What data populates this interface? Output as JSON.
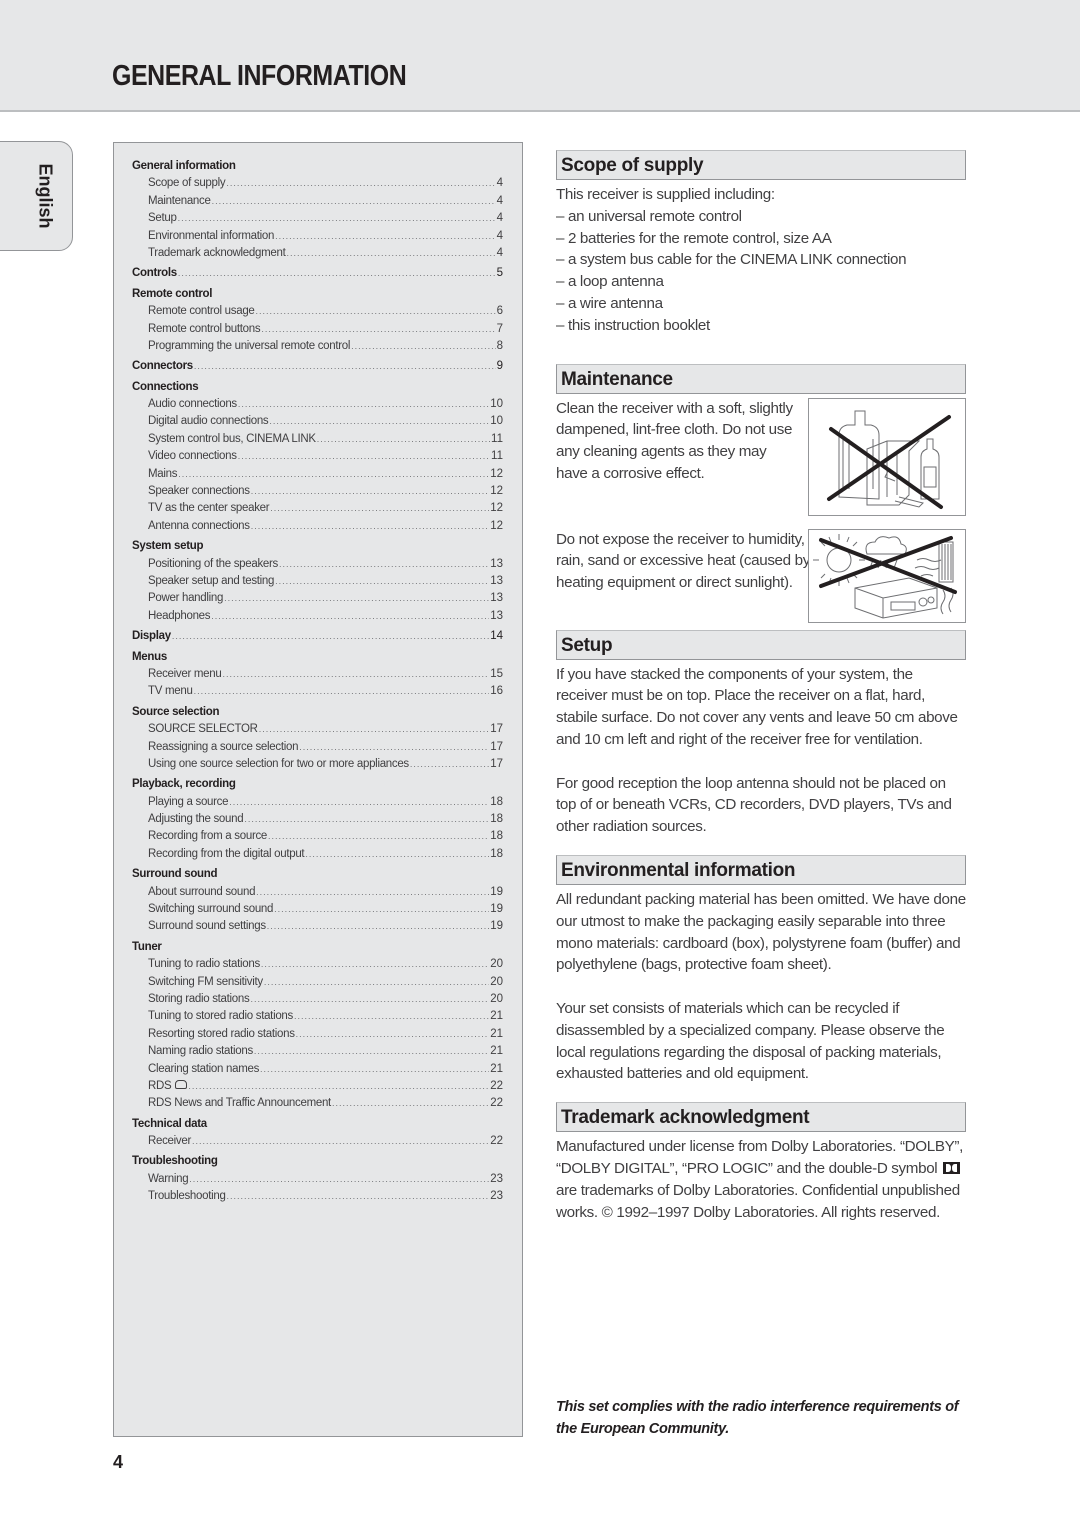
{
  "header": {
    "title": "GENERAL INFORMATION"
  },
  "language_tab": "English",
  "toc": {
    "sections": [
      {
        "title": "General information",
        "page": "",
        "items": [
          {
            "label": "Scope of supply",
            "page": "4"
          },
          {
            "label": "Maintenance",
            "page": "4"
          },
          {
            "label": "Setup",
            "page": "4"
          },
          {
            "label": "Environmental information",
            "page": "4"
          },
          {
            "label": "Trademark acknowledgment",
            "page": "4"
          }
        ]
      },
      {
        "title": "Controls",
        "page": "5",
        "items": []
      },
      {
        "title": "Remote control",
        "page": "",
        "items": [
          {
            "label": "Remote control usage",
            "page": "6"
          },
          {
            "label": "Remote control buttons",
            "page": "7"
          },
          {
            "label": "Programming the universal remote control",
            "page": "8"
          }
        ]
      },
      {
        "title": "Connectors",
        "page": "9",
        "items": []
      },
      {
        "title": "Connections",
        "page": "",
        "items": [
          {
            "label": "Audio connections",
            "page": "10"
          },
          {
            "label": "Digital audio connections",
            "page": "10"
          },
          {
            "label": "System control bus, CINEMA LINK",
            "page": "11"
          },
          {
            "label": "Video connections",
            "page": "11"
          },
          {
            "label": "Mains",
            "page": "12"
          },
          {
            "label": "Speaker connections",
            "page": "12"
          },
          {
            "label": "TV as the center speaker",
            "page": "12"
          },
          {
            "label": "Antenna connections",
            "page": "12"
          }
        ]
      },
      {
        "title": "System setup",
        "page": "",
        "items": [
          {
            "label": "Positioning of the speakers",
            "page": "13"
          },
          {
            "label": "Speaker setup and testing",
            "page": "13"
          },
          {
            "label": "Power handling",
            "page": "13"
          },
          {
            "label": "Headphones",
            "page": "13"
          }
        ]
      },
      {
        "title": "Display",
        "page": "14",
        "items": []
      },
      {
        "title": "Menus",
        "page": "",
        "items": [
          {
            "label": "Receiver menu",
            "page": "15"
          },
          {
            "label": "TV menu",
            "page": "16"
          }
        ]
      },
      {
        "title": "Source selection",
        "page": "",
        "items": [
          {
            "label": "SOURCE SELECTOR",
            "page": "17"
          },
          {
            "label": "Reassigning a source selection",
            "page": "17"
          },
          {
            "label": "Using one source selection for two or more appliances",
            "page": "17"
          }
        ]
      },
      {
        "title": "Playback, recording",
        "page": "",
        "items": [
          {
            "label": "Playing a source",
            "page": "18"
          },
          {
            "label": "Adjusting the sound",
            "page": "18"
          },
          {
            "label": "Recording from a source",
            "page": "18"
          },
          {
            "label": "Recording from the digital output",
            "page": "18"
          }
        ]
      },
      {
        "title": "Surround sound",
        "page": "",
        "items": [
          {
            "label": "About surround sound",
            "page": "19"
          },
          {
            "label": "Switching surround sound",
            "page": "19"
          },
          {
            "label": "Surround sound settings",
            "page": "19"
          }
        ]
      },
      {
        "title": "Tuner",
        "page": "",
        "items": [
          {
            "label": "Tuning to radio stations",
            "page": "20"
          },
          {
            "label": "Switching FM sensitivity",
            "page": "20"
          },
          {
            "label": "Storing radio stations",
            "page": "20"
          },
          {
            "label": "Tuning to stored radio stations",
            "page": "21"
          },
          {
            "label": "Resorting stored radio stations",
            "page": "21"
          },
          {
            "label": "Naming radio stations",
            "page": "21"
          },
          {
            "label": "Clearing station names",
            "page": "21"
          },
          {
            "label": "RDS",
            "page": "22",
            "icon": "rds-logo-icon"
          },
          {
            "label": "RDS News and Traffic Announcement",
            "page": "22"
          }
        ]
      },
      {
        "title": "Technical data",
        "page": "",
        "items": [
          {
            "label": "Receiver",
            "page": "22"
          }
        ]
      },
      {
        "title": "Troubleshooting",
        "page": "",
        "items": [
          {
            "label": "Warning",
            "page": "23"
          },
          {
            "label": "Troubleshooting",
            "page": "23"
          }
        ]
      }
    ]
  },
  "scope_of_supply": {
    "heading": "Scope of supply",
    "intro": "This receiver is supplied including:",
    "items": [
      "– an universal remote control",
      "– 2 batteries for the remote control, size AA",
      "– a system bus cable for the CINEMA LINK connection",
      "– a loop antenna",
      "– a wire antenna",
      "– this instruction booklet"
    ]
  },
  "maintenance": {
    "heading": "Maintenance",
    "p1": "Clean the receiver with a soft, slightly dampened, lint-free cloth. Do not use any cleaning agents as they may have a corrosive effect.",
    "p2": "Do not expose the receiver to humidity, rain, sand or excessive heat (caused by heating equipment or direct sunlight).",
    "fig1_icon": "no-cleaning-agents-icon",
    "fig2_icon": "no-heat-humidity-icon"
  },
  "setup": {
    "heading": "Setup",
    "p1": "If you have stacked the components of your system, the receiver must be on top. Place the receiver on a flat, hard, stabile surface. Do not cover any vents and leave 50 cm above and 10 cm left and right of the receiver free for ventilation.",
    "p2": "For good reception the loop antenna should not be placed on top of or beneath VCRs, CD recorders, DVD players, TVs and other radiation sources."
  },
  "environmental": {
    "heading": "Environmental information",
    "p1": "All redundant packing material has been omitted. We have done our utmost to make the packaging easily separable into three mono materials: cardboard (box), polystyrene foam (buffer) and polyethylene (bags, protective foam sheet).",
    "p2": "Your set consists of materials which can be recycled if disassembled by a specialized company. Please observe the local regulations regarding the disposal of packing materials, exhausted batteries and old equipment."
  },
  "trademark": {
    "heading": "Trademark acknowledgment",
    "p1_before": "Manufactured under license from Dolby Laboratories. “DOLBY”, “DOLBY DIGITAL”, “PRO LOGIC” and the double-D symbol",
    "p1_after": "are trademarks of Dolby Laboratories. Confidential unpublished works. © 1992–1997 Dolby Laboratories. All rights reserved."
  },
  "compliance_note": "This set complies with the radio interference requirements of the European Community.",
  "page_number": "4"
}
